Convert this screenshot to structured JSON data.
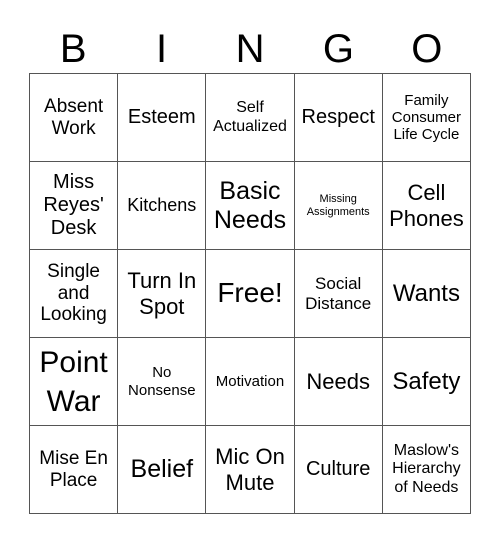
{
  "header": {
    "letters": [
      "B",
      "I",
      "N",
      "G",
      "O"
    ]
  },
  "rows": [
    [
      "Absent Work",
      "Esteem",
      "Self Actualized",
      "Respect",
      "Family Consumer Life Cycle"
    ],
    [
      "Miss Reyes' Desk",
      "Kitchens",
      "Basic Needs",
      "Missing Assignments",
      "Cell Phones"
    ],
    [
      "Single and Looking",
      "Turn In Spot",
      "Free!",
      "Social Distance",
      "Wants"
    ],
    [
      "Point War",
      "No Nonsense",
      "Motivation",
      "Needs",
      "Safety"
    ],
    [
      "Mise En Place",
      "Belief",
      "Mic On Mute",
      "Culture",
      "Maslow's Hierarchy of Needs"
    ]
  ]
}
